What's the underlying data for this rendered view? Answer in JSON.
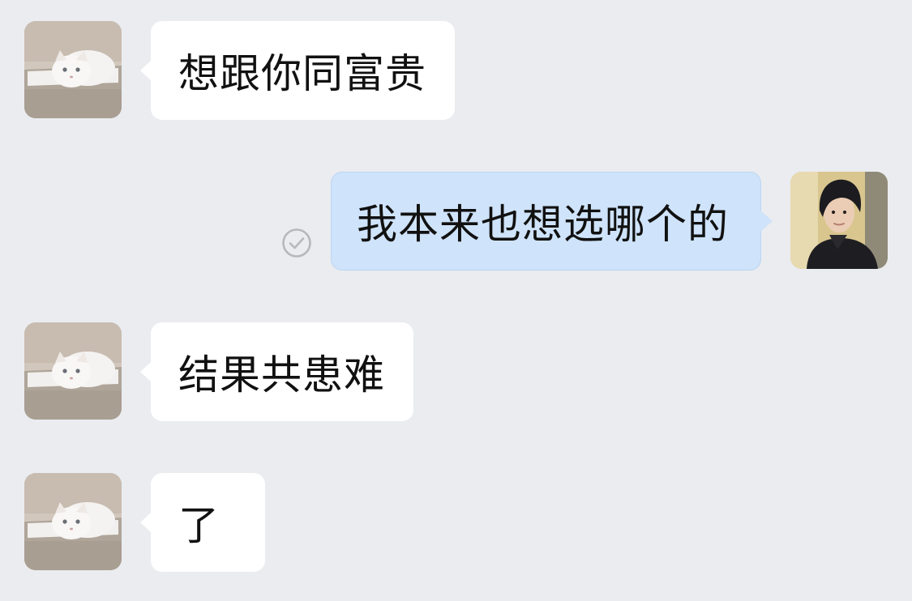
{
  "messages": [
    {
      "side": "incoming",
      "text": "想跟你同富贵",
      "avatar": "cat-avatar"
    },
    {
      "side": "outgoing",
      "text": "我本来也想选哪个的",
      "avatar": "person-avatar",
      "status_icon": "read-check-icon"
    },
    {
      "side": "incoming",
      "text": "结果共患难",
      "avatar": "cat-avatar"
    },
    {
      "side": "incoming",
      "text": "了",
      "avatar": "cat-avatar"
    }
  ],
  "colors": {
    "background": "#EAECF0",
    "incoming_bubble": "#FFFFFF",
    "outgoing_bubble": "#CFE3FA",
    "text": "#111111",
    "status_icon": "#B5B8BD"
  }
}
